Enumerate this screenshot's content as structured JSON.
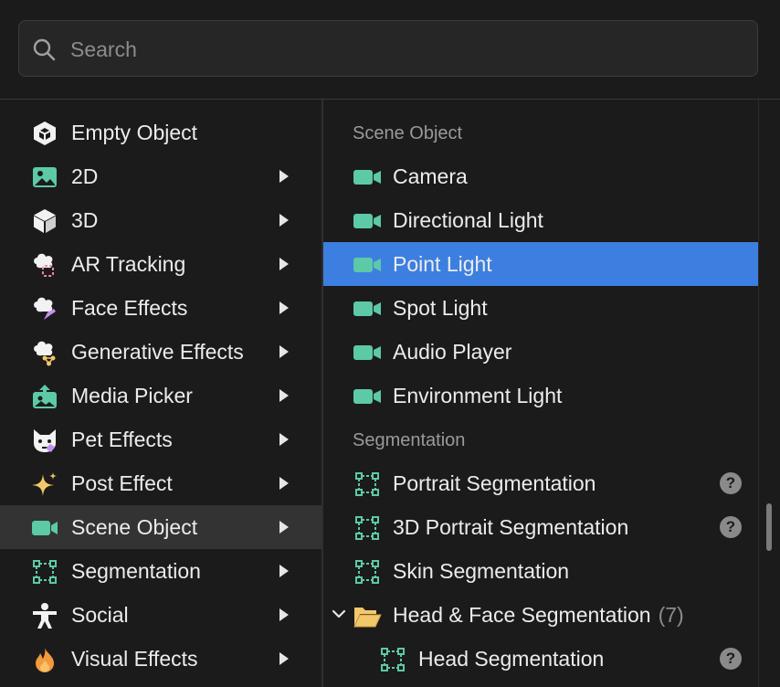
{
  "search": {
    "placeholder": "Search",
    "value": ""
  },
  "categories": [
    {
      "label": "Empty Object",
      "icon": "cube-outline-icon",
      "has_submenu": false
    },
    {
      "label": "2D",
      "icon": "image-icon",
      "has_submenu": true
    },
    {
      "label": "3D",
      "icon": "cube-icon",
      "has_submenu": true
    },
    {
      "label": "AR Tracking",
      "icon": "ar-tracking-icon",
      "has_submenu": true
    },
    {
      "label": "Face Effects",
      "icon": "face-effects-icon",
      "has_submenu": true
    },
    {
      "label": "Generative Effects",
      "icon": "generative-effects-icon",
      "has_submenu": true
    },
    {
      "label": "Media Picker",
      "icon": "media-picker-icon",
      "has_submenu": true
    },
    {
      "label": "Pet Effects",
      "icon": "pet-effects-icon",
      "has_submenu": true
    },
    {
      "label": "Post Effect",
      "icon": "sparkle-icon",
      "has_submenu": true
    },
    {
      "label": "Scene Object",
      "icon": "camera-icon",
      "has_submenu": true,
      "selected": true
    },
    {
      "label": "Segmentation",
      "icon": "segmentation-icon",
      "has_submenu": true
    },
    {
      "label": "Social",
      "icon": "person-icon",
      "has_submenu": true
    },
    {
      "label": "Visual Effects",
      "icon": "flame-icon",
      "has_submenu": true
    }
  ],
  "submenu": {
    "scene_object_title": "Scene Object",
    "scene_object_items": [
      {
        "label": "Camera",
        "icon": "camera-icon"
      },
      {
        "label": "Directional Light",
        "icon": "camera-icon"
      },
      {
        "label": "Point Light",
        "icon": "camera-icon",
        "active": true
      },
      {
        "label": "Spot Light",
        "icon": "camera-icon"
      },
      {
        "label": "Audio Player",
        "icon": "camera-icon"
      },
      {
        "label": "Environment Light",
        "icon": "camera-icon"
      }
    ],
    "segmentation_title": "Segmentation",
    "segmentation_items": [
      {
        "label": "Portrait Segmentation",
        "icon": "segmentation-icon",
        "help": "?"
      },
      {
        "label": "3D Portrait Segmentation",
        "icon": "segmentation-icon",
        "help": "?"
      },
      {
        "label": "Skin Segmentation",
        "icon": "segmentation-icon"
      }
    ],
    "folder": {
      "label": "Head & Face Segmentation",
      "count": "(7)",
      "icon": "folder-open-icon"
    },
    "folder_items": [
      {
        "label": "Head Segmentation",
        "icon": "segmentation-icon",
        "help": "?"
      }
    ]
  },
  "colors": {
    "accent": "#3d7fe0",
    "icon_green": "#5cc9a7",
    "folder_yellow": "#f3c86b",
    "selected_row": "#333333"
  }
}
